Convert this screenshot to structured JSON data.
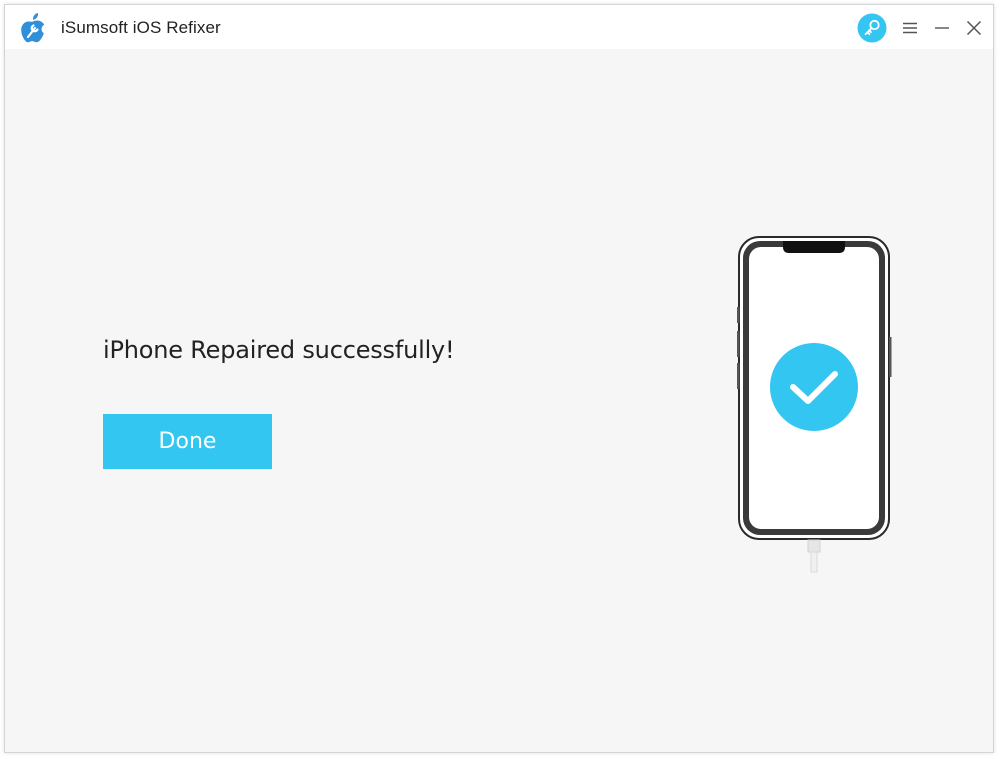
{
  "window": {
    "title": "iSumsoft iOS Refixer"
  },
  "titlebar": {
    "logo_icon": "apple-wrench-logo-icon",
    "controls": [
      {
        "name": "key-icon",
        "role": "register"
      },
      {
        "name": "menu-icon",
        "role": "menu"
      },
      {
        "name": "minimize-icon",
        "role": "minimize"
      },
      {
        "name": "close-icon",
        "role": "close"
      }
    ]
  },
  "main": {
    "status_message": "iPhone Repaired successfully!",
    "done_label": "Done"
  },
  "illustration": {
    "device": "iphone",
    "badge_icon": "checkmark-circle-icon"
  },
  "colors": {
    "accent": "#33c6f1",
    "background": "#f6f6f6",
    "titlebar": "#ffffff",
    "text": "#222222"
  }
}
